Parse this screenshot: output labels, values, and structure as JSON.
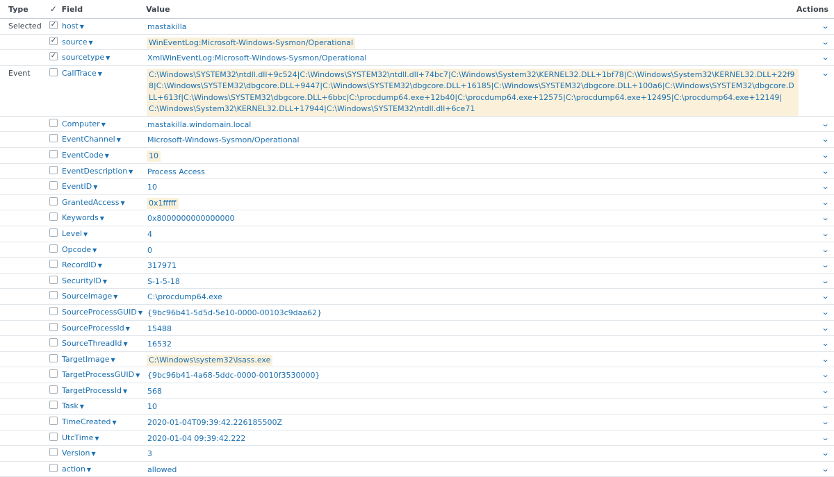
{
  "headers": {
    "type": "Type",
    "field": "Field",
    "value": "Value",
    "actions": "Actions"
  },
  "icons": {
    "checked": "✓",
    "caret": "▼",
    "chevron": "⌄"
  },
  "rows": [
    {
      "type": "Selected",
      "checked": true,
      "field": "host",
      "value": "mastakilla",
      "highlight": false
    },
    {
      "type": "",
      "checked": true,
      "field": "source",
      "value": "WinEventLog:Microsoft-Windows-Sysmon/Operational",
      "highlight": true
    },
    {
      "type": "",
      "checked": true,
      "field": "sourcetype",
      "value": "XmlWinEventLog:Microsoft-Windows-Sysmon/Operational",
      "highlight": false
    },
    {
      "type": "Event",
      "checked": false,
      "field": "CallTrace",
      "value": "C:\\Windows\\SYSTEM32\\ntdll.dll+9c524|C:\\Windows\\SYSTEM32\\ntdll.dll+74bc7|C:\\Windows\\System32\\KERNEL32.DLL+1bf78|C:\\Windows\\System32\\KERNEL32.DLL+22f98|C:\\Windows\\SYSTEM32\\dbgcore.DLL+9447|C:\\Windows\\SYSTEM32\\dbgcore.DLL+16185|C:\\Windows\\SYSTEM32\\dbgcore.DLL+100a6|C:\\Windows\\SYSTEM32\\dbgcore.DLL+613f|C:\\Windows\\SYSTEM32\\dbgcore.DLL+6bbc|C:\\procdump64.exe+12b40|C:\\procdump64.exe+12575|C:\\procdump64.exe+12495|C:\\procdump64.exe+12149|C:\\Windows\\System32\\KERNEL32.DLL+17944|C:\\Windows\\SYSTEM32\\ntdll.dll+6ce71",
      "highlight": true,
      "block": true
    },
    {
      "type": "",
      "checked": false,
      "field": "Computer",
      "value": "mastakilla.windomain.local",
      "highlight": false
    },
    {
      "type": "",
      "checked": false,
      "field": "EventChannel",
      "value": "Microsoft-Windows-Sysmon/Operational",
      "highlight": false
    },
    {
      "type": "",
      "checked": false,
      "field": "EventCode",
      "value": "10",
      "highlight": true
    },
    {
      "type": "",
      "checked": false,
      "field": "EventDescription",
      "value": "Process Access",
      "highlight": false
    },
    {
      "type": "",
      "checked": false,
      "field": "EventID",
      "value": "10",
      "highlight": false
    },
    {
      "type": "",
      "checked": false,
      "field": "GrantedAccess",
      "value": "0x1fffff",
      "highlight": true
    },
    {
      "type": "",
      "checked": false,
      "field": "Keywords",
      "value": "0x8000000000000000",
      "highlight": false
    },
    {
      "type": "",
      "checked": false,
      "field": "Level",
      "value": "4",
      "highlight": false
    },
    {
      "type": "",
      "checked": false,
      "field": "Opcode",
      "value": "0",
      "highlight": false
    },
    {
      "type": "",
      "checked": false,
      "field": "RecordID",
      "value": "317971",
      "highlight": false
    },
    {
      "type": "",
      "checked": false,
      "field": "SecurityID",
      "value": "S-1-5-18",
      "highlight": false
    },
    {
      "type": "",
      "checked": false,
      "field": "SourceImage",
      "value": "C:\\procdump64.exe",
      "highlight": false
    },
    {
      "type": "",
      "checked": false,
      "field": "SourceProcessGUID",
      "value": "{9bc96b41-5d5d-5e10-0000-00103c9daa62}",
      "highlight": false
    },
    {
      "type": "",
      "checked": false,
      "field": "SourceProcessId",
      "value": "15488",
      "highlight": false
    },
    {
      "type": "",
      "checked": false,
      "field": "SourceThreadId",
      "value": "16532",
      "highlight": false
    },
    {
      "type": "",
      "checked": false,
      "field": "TargetImage",
      "value": "C:\\Windows\\system32\\lsass.exe",
      "highlight": true
    },
    {
      "type": "",
      "checked": false,
      "field": "TargetProcessGUID",
      "value": "{9bc96b41-4a68-5ddc-0000-0010f3530000}",
      "highlight": false
    },
    {
      "type": "",
      "checked": false,
      "field": "TargetProcessId",
      "value": "568",
      "highlight": false
    },
    {
      "type": "",
      "checked": false,
      "field": "Task",
      "value": "10",
      "highlight": false
    },
    {
      "type": "",
      "checked": false,
      "field": "TimeCreated",
      "value": "2020-01-04T09:39:42.226185500Z",
      "highlight": false
    },
    {
      "type": "",
      "checked": false,
      "field": "UtcTime",
      "value": "2020-01-04 09:39:42.222",
      "highlight": false
    },
    {
      "type": "",
      "checked": false,
      "field": "Version",
      "value": "3",
      "highlight": false
    },
    {
      "type": "",
      "checked": false,
      "field": "action",
      "value": "allowed",
      "highlight": false
    }
  ]
}
